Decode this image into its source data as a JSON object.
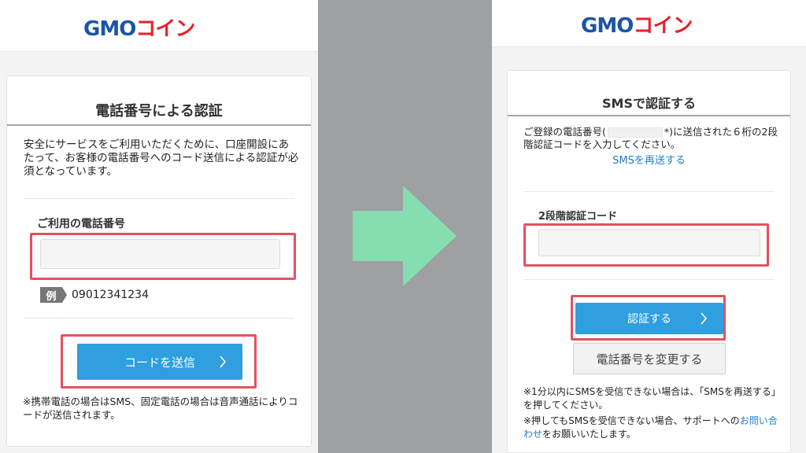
{
  "brand": {
    "logo_gmo": "GMO",
    "logo_coin": "コイン"
  },
  "left": {
    "title": "電話番号による認証",
    "intro": "安全にサービスをご利用いただくために、口座開設にあたって、お客様の電話番号へのコード送信による認証が必須となっています。",
    "phone_label": "ご利用の電話番号",
    "phone_value": "",
    "example_badge": "例",
    "example_value": "09012341234",
    "send_button": "コードを送信",
    "footnote": "※携帯電話の場合はSMS、固定電話の場合は音声通話によりコードが送信されます。"
  },
  "right": {
    "title": "SMSで認証する",
    "intro_pre": "ご登録の電話番号(",
    "intro_masked_tail": "*",
    "intro_post": ")に送信された６桁の2段階認証コードを入力してください。",
    "resend_link": "SMSを再送する",
    "code_label": "2段階認証コード",
    "code_value": "",
    "verify_button": "認証する",
    "change_phone_button": "電話番号を変更する",
    "note1": "※1分以内にSMSを受信できない場合は、「SMSを再送する」を押してください。",
    "note2_pre": "※押してもSMSを受信できない場合、サポートへの",
    "note2_link": "お問い合わせ",
    "note2_post": "をお願いいたします。"
  },
  "colors": {
    "highlight": "#e4505e",
    "primary_button": "#2f9fe0",
    "arrow": "#86ddb0",
    "divider": "#9fa0a2",
    "logo_blue": "#1b55a6",
    "logo_red": "#e7212b"
  },
  "icons": {
    "chevron": "chevron-right-icon",
    "flow_arrow": "flow-arrow-icon"
  }
}
